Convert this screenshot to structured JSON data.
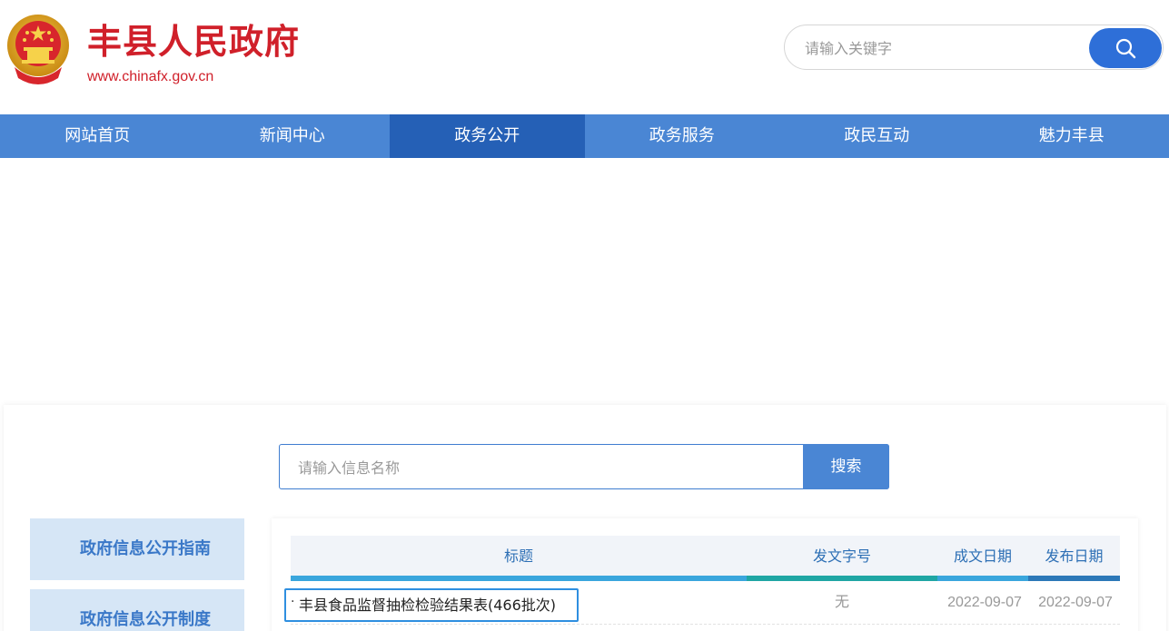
{
  "header": {
    "site_title": "丰县人民政府",
    "site_url": "www.chinafx.gov.cn",
    "search_placeholder": "请输入关键字",
    "emblem_icon": "national-emblem-icon"
  },
  "nav": {
    "items": [
      {
        "label": "网站首页"
      },
      {
        "label": "新闻中心"
      },
      {
        "label": "政务公开",
        "active": true
      },
      {
        "label": "政务服务"
      },
      {
        "label": "政民互动"
      },
      {
        "label": "魅力丰县"
      }
    ]
  },
  "info_search": {
    "placeholder": "请输入信息名称",
    "button_label": "搜索"
  },
  "sidebar": {
    "items": [
      {
        "label": "政府信息公开指南"
      },
      {
        "label": "政府信息公开制度"
      }
    ]
  },
  "table": {
    "columns": [
      "标题",
      "发文字号",
      "成文日期",
      "发布日期"
    ],
    "rows": [
      {
        "bullet": "·",
        "title": "丰县食品监督抽检检验结果表(466批次)",
        "doc_number": "无",
        "created_date": "2022-09-07",
        "published_date": "2022-09-07"
      }
    ]
  },
  "colors": {
    "brand_red": "#d0202a",
    "nav_blue": "#4a86d4",
    "nav_active": "#2560b6",
    "search_blue": "#2e6fd8",
    "sidebar_bg": "#d6e6f6",
    "bar_light_blue": "#3aa6dd",
    "bar_teal": "#1fa6a4",
    "bar_dark_blue": "#2c78b8"
  }
}
